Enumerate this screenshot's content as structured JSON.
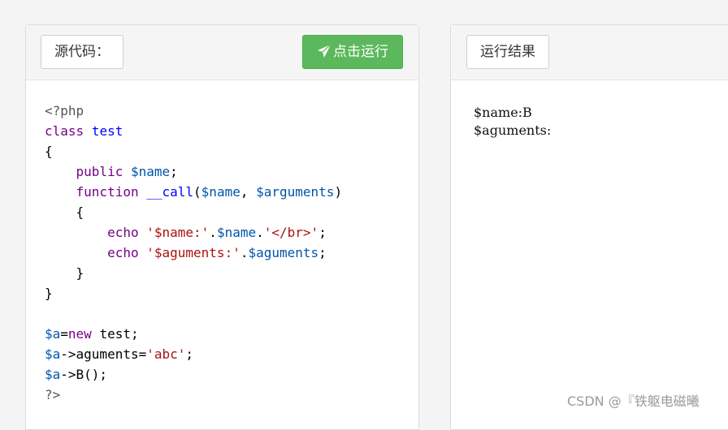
{
  "source_panel": {
    "label": "源代码：",
    "run_button": "点击运行",
    "run_icon": "paper-plane-icon",
    "code": [
      [
        [
          "meta",
          "<?php"
        ]
      ],
      [
        [
          "kw",
          "class"
        ],
        [
          "plain",
          " "
        ],
        [
          "def",
          "test"
        ]
      ],
      [
        [
          "plain",
          "{"
        ]
      ],
      [
        [
          "plain",
          "    "
        ],
        [
          "kw",
          "public"
        ],
        [
          "plain",
          " "
        ],
        [
          "var",
          "$name"
        ],
        [
          "plain",
          ";"
        ]
      ],
      [
        [
          "plain",
          "    "
        ],
        [
          "kw",
          "function"
        ],
        [
          "plain",
          " "
        ],
        [
          "def",
          "__call"
        ],
        [
          "plain",
          "("
        ],
        [
          "var",
          "$name"
        ],
        [
          "plain",
          ", "
        ],
        [
          "var",
          "$arguments"
        ],
        [
          "plain",
          ")"
        ]
      ],
      [
        [
          "plain",
          "    {"
        ]
      ],
      [
        [
          "plain",
          "        "
        ],
        [
          "kw",
          "echo"
        ],
        [
          "plain",
          " "
        ],
        [
          "str",
          "'$name:'"
        ],
        [
          "plain",
          "."
        ],
        [
          "var",
          "$name"
        ],
        [
          "plain",
          "."
        ],
        [
          "str",
          "'</br>'"
        ],
        [
          "plain",
          ";"
        ]
      ],
      [
        [
          "plain",
          "        "
        ],
        [
          "kw",
          "echo"
        ],
        [
          "plain",
          " "
        ],
        [
          "str",
          "'$aguments:'"
        ],
        [
          "plain",
          "."
        ],
        [
          "var",
          "$aguments"
        ],
        [
          "plain",
          ";"
        ]
      ],
      [
        [
          "plain",
          "    }"
        ]
      ],
      [
        [
          "plain",
          "}"
        ]
      ],
      [
        [
          "plain",
          ""
        ]
      ],
      [
        [
          "var",
          "$a"
        ],
        [
          "plain",
          "="
        ],
        [
          "kw",
          "new"
        ],
        [
          "plain",
          " test;"
        ]
      ],
      [
        [
          "var",
          "$a"
        ],
        [
          "plain",
          "->aguments="
        ],
        [
          "str",
          "'abc'"
        ],
        [
          "plain",
          ";"
        ]
      ],
      [
        [
          "var",
          "$a"
        ],
        [
          "plain",
          "->B();"
        ]
      ],
      [
        [
          "meta",
          "?>"
        ]
      ]
    ]
  },
  "result_panel": {
    "label": "运行结果",
    "output": [
      "$name:B",
      "$aguments:"
    ]
  },
  "watermark": "CSDN @『铁躯电磁曦"
}
